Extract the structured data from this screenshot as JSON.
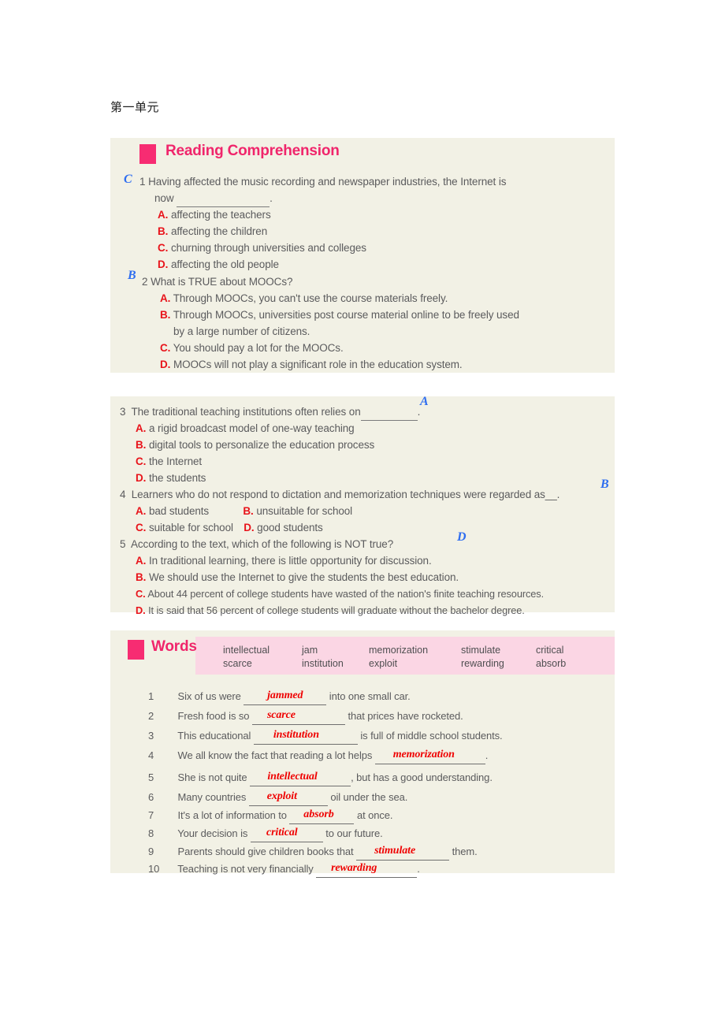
{
  "document": {
    "title": "第一单元"
  },
  "reading": {
    "section_label": "Reading Comprehension",
    "marker_color": "#f72c72",
    "title_color": "#f0256b",
    "panel_bg": "#f2f1e5",
    "questions": [
      {
        "number": "1",
        "handwritten_answer": "C",
        "stem_part1": "Having affected the music recording and newspaper industries, the Internet is",
        "stem_part2_prefix": "now",
        "stem_part2_suffix": ".",
        "options": [
          {
            "letter": "A.",
            "text": "affecting the teachers"
          },
          {
            "letter": "B.",
            "text": "affecting the children"
          },
          {
            "letter": "C.",
            "text": "churning through universities and colleges"
          },
          {
            "letter": "D.",
            "text": "affecting the old people"
          }
        ]
      },
      {
        "number": "2",
        "handwritten_answer": "B",
        "stem": "What is TRUE about MOOCs?",
        "options": [
          {
            "letter": "A.",
            "text": "Through MOOCs, you can't use the course materials freely."
          },
          {
            "letter": "B.",
            "text": "Through MOOCs, universities post course material online to be freely used"
          },
          {
            "letter": "",
            "text": "by a large number of citizens."
          },
          {
            "letter": "C.",
            "text": "You should pay a lot for the MOOCs."
          },
          {
            "letter": "D.",
            "text": "MOOCs will not play a significant role in the education system."
          }
        ]
      }
    ]
  },
  "reading_more": {
    "questions": [
      {
        "number": "3",
        "handwritten_answer": "A",
        "stem_prefix": "The traditional teaching institutions often relies on",
        "stem_suffix": ".",
        "options": [
          {
            "letter": "A.",
            "text": "a rigid broadcast model of one-way teaching"
          },
          {
            "letter": "B.",
            "text": "digital tools to personalize the education process"
          },
          {
            "letter": "C.",
            "text": "the Internet"
          },
          {
            "letter": "D.",
            "text": "the students"
          }
        ]
      },
      {
        "number": "4",
        "handwritten_answer": "B",
        "stem": "Learners who do not respond to dictation and memorization techniques were regarded as__.",
        "options_inline": [
          {
            "letter": "A.",
            "text": "bad students"
          },
          {
            "letter": "B.",
            "text": "unsuitable for school"
          },
          {
            "letter": "C.",
            "text": "suitable for school"
          },
          {
            "letter": "D.",
            "text": "good students"
          }
        ]
      },
      {
        "number": "5",
        "handwritten_answer": "D",
        "stem": "According to the text, which of the following is NOT true?",
        "options": [
          {
            "letter": "A.",
            "text": "In traditional learning, there is little opportunity for discussion."
          },
          {
            "letter": "B.",
            "text": "We should use the Internet to give the students the best education."
          },
          {
            "letter": "C.",
            "text": "About 44 percent of college students have wasted of the nation's finite teaching resources."
          },
          {
            "letter": "D.",
            "text": "It is said that 56 percent of college students will graduate without the bachelor degree."
          }
        ]
      }
    ]
  },
  "words": {
    "section_label": "Words",
    "band_color": "#fbd6e4",
    "word_bank": [
      {
        "top": "intellectual",
        "bottom": "scarce"
      },
      {
        "top": "jam",
        "bottom": "institution"
      },
      {
        "top": "memorization",
        "bottom": "exploit"
      },
      {
        "top": "stimulate",
        "bottom": "rewarding"
      },
      {
        "top": "critical",
        "bottom": "absorb"
      }
    ],
    "exercises": [
      {
        "number": "1",
        "before": "Six of us were",
        "answer": "jammed",
        "after": "into one small car."
      },
      {
        "number": "2",
        "before": "Fresh food is so",
        "answer": "scarce",
        "after": "that prices have rocketed."
      },
      {
        "number": "3",
        "before": "This educational",
        "answer": "institution",
        "after": "is full of middle school students."
      },
      {
        "number": "4",
        "before": "We all know the fact that reading a lot helps",
        "answer": "memorization",
        "after": "."
      },
      {
        "number": "5",
        "before": "She is not quite",
        "answer": "intellectual",
        "after": ", but has a good understanding."
      },
      {
        "number": "6",
        "before": "Many countries",
        "answer": "exploit",
        "after": "oil under the sea."
      },
      {
        "number": "7",
        "before": "It's a lot of information to",
        "answer": "absorb",
        "after": "at once."
      },
      {
        "number": "8",
        "before": "Your decision is",
        "answer": "critical",
        "after": "to our future."
      },
      {
        "number": "9",
        "before": "Parents should give children books that",
        "answer": "stimulate",
        "after": "them."
      },
      {
        "number": "10",
        "before": "Teaching is not very financially",
        "answer": "rewarding",
        "after": "."
      }
    ]
  }
}
